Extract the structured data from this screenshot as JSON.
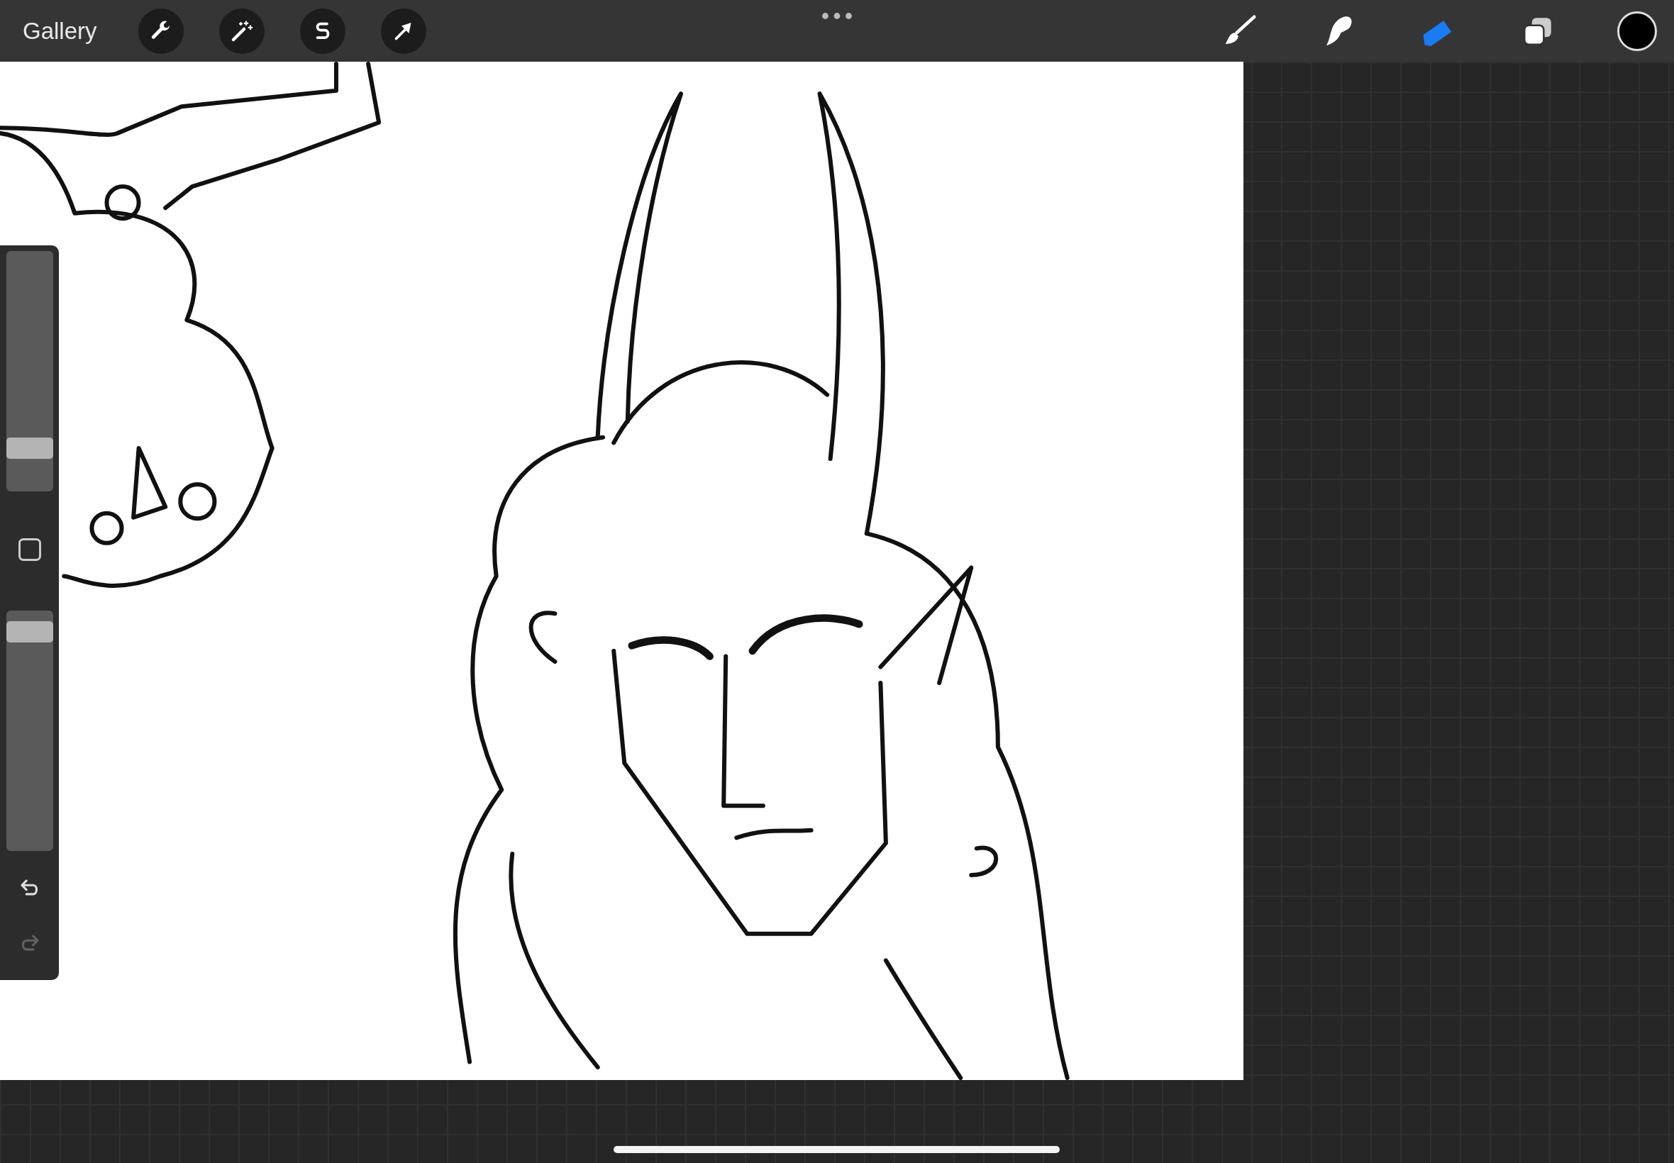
{
  "top_bar": {
    "gallery": "Gallery",
    "actions": [
      {
        "kind": "wrench"
      },
      {
        "kind": "wand"
      },
      {
        "kind": "selection"
      },
      {
        "kind": "transform"
      }
    ],
    "tools": [
      {
        "kind": "brush",
        "selected": false
      },
      {
        "kind": "smudge",
        "selected": false
      },
      {
        "kind": "eraser",
        "selected": true
      }
    ]
  },
  "sidebar": {
    "size_slider": {
      "level": 0.15
    },
    "opacity_slider": {
      "level": 0.95
    },
    "undo": {
      "disabled": false
    },
    "redo": {
      "disabled": true
    }
  }
}
